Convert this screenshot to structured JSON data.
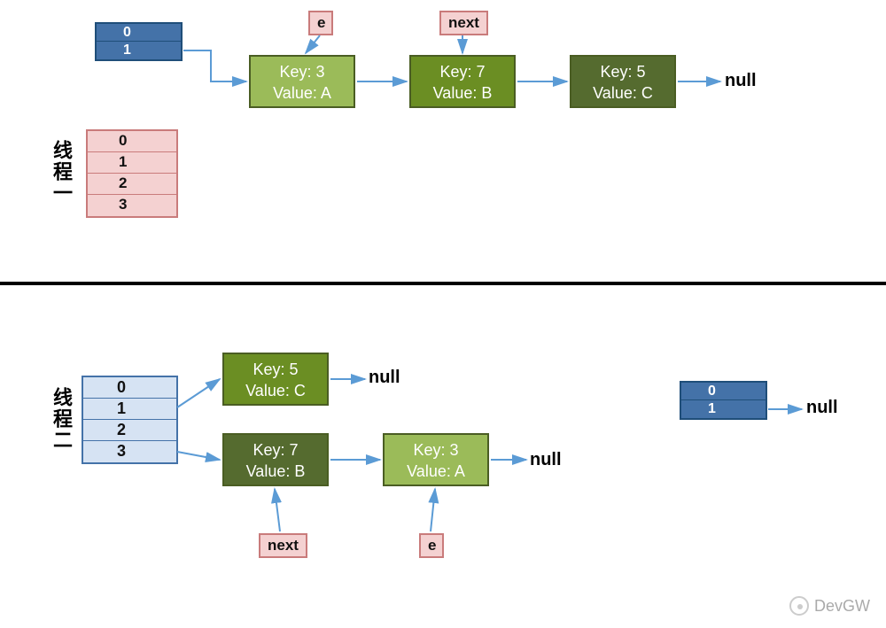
{
  "top": {
    "blueTable": {
      "rows": [
        "0",
        "1"
      ]
    },
    "labels": {
      "e": "e",
      "next": "next"
    },
    "nodes": [
      {
        "key": "Key: 3",
        "value": "Value: A"
      },
      {
        "key": "Key: 7",
        "value": "Value: B"
      },
      {
        "key": "Key: 5",
        "value": "Value: C"
      }
    ],
    "null": "null",
    "pinkTable": {
      "rows": [
        "0",
        "1",
        "2",
        "3"
      ]
    },
    "threadLabel": "线程一"
  },
  "bottom": {
    "threadLabel": "线程二",
    "lblueTable": {
      "rows": [
        "0",
        "1",
        "2",
        "3"
      ]
    },
    "nodes": {
      "n1": {
        "key": "Key: 5",
        "value": "Value: C"
      },
      "n2": {
        "key": "Key: 7",
        "value": "Value: B"
      },
      "n3": {
        "key": "Key: 3",
        "value": "Value: A"
      }
    },
    "nulls": {
      "a": "null",
      "b": "null",
      "c": "null"
    },
    "labels": {
      "next": "next",
      "e": "e"
    },
    "blueTable": {
      "rows": [
        "0",
        "1"
      ]
    }
  },
  "watermark": "DevGW"
}
